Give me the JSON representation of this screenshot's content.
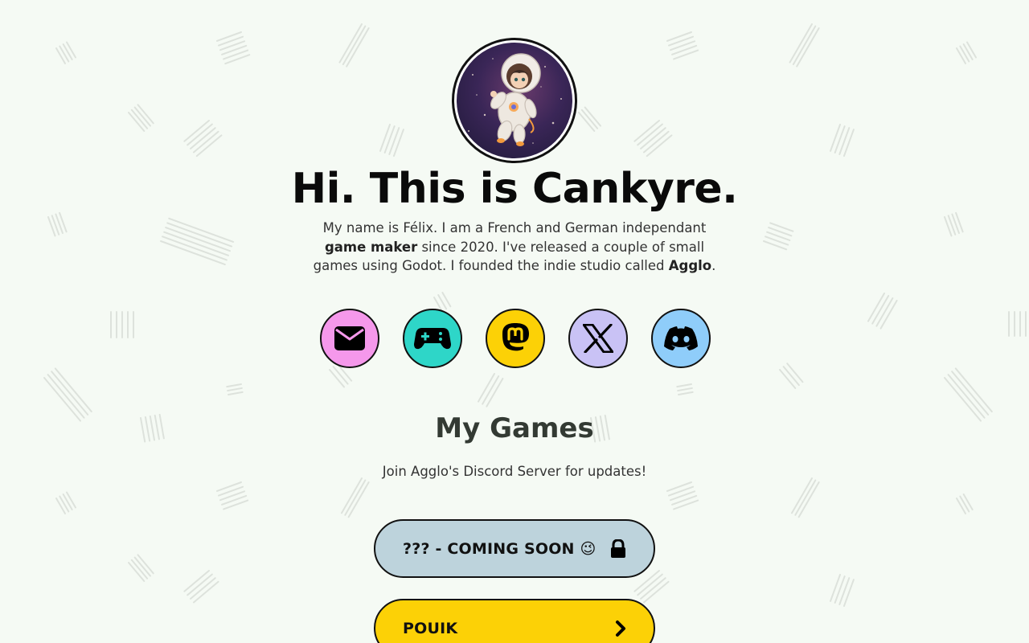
{
  "profile": {
    "avatar_alt": "Astronaut avatar",
    "title": "Hi. This is Cankyre.",
    "bio_part1": "My name is Félix. I am a French and German independant ",
    "bio_bold1": "game maker",
    "bio_part2": " since 2020. I've released a couple of small games using Godot. I founded the indie studio called ",
    "bio_bold2": "Agglo",
    "bio_part3": "."
  },
  "socials": [
    {
      "name": "email",
      "icon": "envelope-icon",
      "color": "#f598eb"
    },
    {
      "name": "itch",
      "icon": "gamepad-icon",
      "color": "#2ed6c8"
    },
    {
      "name": "mastodon",
      "icon": "mastodon-icon",
      "color": "#fcd106"
    },
    {
      "name": "x",
      "icon": "x-icon",
      "color": "#c9c2f5"
    },
    {
      "name": "discord",
      "icon": "discord-icon",
      "color": "#8fcdfa"
    }
  ],
  "games": {
    "title": "My Games",
    "subtitle": "Join Agglo's Discord Server for updates!",
    "items": [
      {
        "label": "??? - COMING SOON 😉",
        "icon": "lock-icon",
        "color": "#bdd3dc"
      },
      {
        "label": "POUIK",
        "icon": "chevron-right-icon",
        "color": "#fcd106"
      }
    ]
  },
  "colors": {
    "background": "#f5faf4",
    "text": "#111111"
  }
}
